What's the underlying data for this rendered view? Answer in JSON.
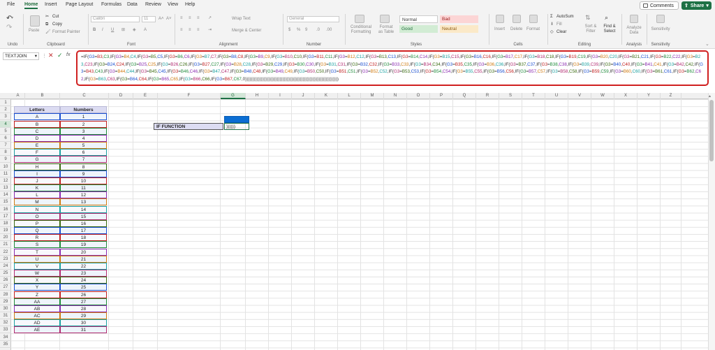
{
  "menu": {
    "tabs": [
      "File",
      "Home",
      "Insert",
      "Page Layout",
      "Formulas",
      "Data",
      "Review",
      "View",
      "Help"
    ],
    "active": "Home",
    "comments": "Comments",
    "share": "Share"
  },
  "ribbon": {
    "undo_group": "Undo",
    "clipboard": {
      "label": "Clipboard",
      "paste": "Paste",
      "cut": "Cut",
      "copy": "Copy",
      "format_painter": "Format Painter"
    },
    "font": {
      "label": "Font",
      "name": "Calibri",
      "size": "11",
      "bold": "B",
      "italic": "I",
      "underline": "U"
    },
    "alignment": {
      "label": "Alignment",
      "wrap": "Wrap Text",
      "merge": "Merge & Center"
    },
    "number": {
      "label": "Number",
      "format": "General"
    },
    "styles": {
      "label": "Styles",
      "conditional": "Conditional Formatting",
      "format_table": "Format as Table",
      "normal": "Normal",
      "bad": "Bad",
      "good": "Good",
      "neutral": "Neutral"
    },
    "cells": {
      "label": "Cells",
      "insert": "Insert",
      "delete": "Delete",
      "format": "Format"
    },
    "editing": {
      "label": "Editing",
      "autosum": "AutoSum",
      "fill": "Fill",
      "clear": "Clear",
      "sort": "Sort & Filter",
      "find": "Find & Select"
    },
    "analysis": {
      "label": "Analysis",
      "analyze": "Analyze Data"
    },
    "sensitivity": {
      "label": "Sensitivity",
      "btn": "Sensitivity"
    }
  },
  "formula_bar": {
    "name_box": "TEXTJOIN",
    "formula": "=IF(G3=B3,C3,IF(G3=B4,C4,IF(G3=B5,C5,IF(G3=B6,C6,IF(G3=B7,C7,IF(G3=B8,C8,IF(G3=B9,C9,IF(G3=B10,C10,IF(G3=B11,C11,IF(G3=B12,C12,IF(G3=B13,C13,IF(G3=B14,C14,IF(G3=B15,C15,IF(G3=B16,C16,IF(G3=B17,C17,IF(G3=B18,C18,IF(G3=B19,C19,IF(G3=B20,C20,IF(G3=B21,C21,IF(G3=B22,C22,IF(G3=B23,C23,IF(G3=B24,C24,IF(G3=B25,C25,IF(G3=B26,C26,IF(G3=B27,C27,IF(G3=B28,C28,IF(G3=B29,C29,IF(G3=B30,C30,IF(G3=B31,C31,IF(G3=B32,C32,IF(G3=B33,C33,IF(G3=B34,C34,IF(G3=B35,C35,IF(G3=B36,C36,IF(G3=B37,C37,IF(G3=B38,C38,IF(G3=B39,C39,IF(G3=B40,C40,IF(G3=B41,C41,IF(G3=B42,C42,IF(G3=B43,C43,IF(G3=B44,C44,IF(G3=B45,C45,IF(G3=B46,C46,IF(G3=B47,C47,IF(G3=B48,C48,IF(G3=B49,C49,IF(G3=B50,C50,IF(G3=B51,C51,IF(G3=B52,C52,IF(G3=B53,C53,IF(G3=B54,C54,IF(G3=B55,C55,IF(G3=B56,C56,IF(G3=B57,C57,IF(G3=B58,C58,IF(G3=B59,C59,IF(G3=B60,C60,IF(G3=B61,C61,IF(G3=B62,C62,IF(G3=B63,C63,IF(G3=B64,C64,IF(G3=B65,C65,IF(G3=B66,C66,IF(G3=B67,C67,0)))))))))))))))))))))))))))))))))))))))))))))))))))))))))))))))))"
  },
  "columns": [
    "A",
    "B",
    "C",
    "D",
    "E",
    "F",
    "G",
    "H",
    "I",
    "J",
    "K",
    "L",
    "M",
    "N",
    "O",
    "P",
    "Q",
    "R",
    "S",
    "T",
    "U",
    "V",
    "W",
    "X",
    "Y",
    "Z"
  ],
  "selected_column": "G",
  "selected_row": "4",
  "rows": [
    "1",
    "2",
    "3",
    "4",
    "5",
    "6",
    "7",
    "8",
    "9",
    "10",
    "11",
    "12",
    "13",
    "14",
    "15",
    "16",
    "17",
    "18",
    "19",
    "20",
    "21",
    "22",
    "23",
    "24",
    "25",
    "26",
    "27",
    "28",
    "29",
    "30",
    "31",
    "32",
    "33",
    "34",
    "35"
  ],
  "table": {
    "header_letters": "Letters",
    "header_numbers": "Numbers",
    "letters": [
      "A",
      "B",
      "C",
      "D",
      "E",
      "F",
      "G",
      "H",
      "I",
      "J",
      "K",
      "L",
      "M",
      "N",
      "O",
      "P",
      "Q",
      "R",
      "S",
      "T",
      "U",
      "V",
      "W",
      "X",
      "Y",
      "Z",
      "AA",
      "AB",
      "AC",
      "AD",
      "AE"
    ],
    "numbers": [
      "1",
      "2",
      "3",
      "4",
      "5",
      "6",
      "7",
      "8",
      "9",
      "10",
      "11",
      "12",
      "13",
      "14",
      "15",
      "16",
      "17",
      "18",
      "19",
      "20",
      "21",
      "22",
      "23",
      "24",
      "25",
      "26",
      "27",
      "28",
      "29",
      "30",
      "31"
    ]
  },
  "if_label": "IF FUNCTION",
  "if_cell_value": "))))))",
  "colors": {
    "accent": "#1e7145",
    "formula_border": "#d02020",
    "cell_selected": "#0b6ed3",
    "row_palette": [
      "#1a4fd0",
      "#c02020",
      "#1e8a3a",
      "#8a2ab0",
      "#d07a10",
      "#1aa0a0",
      "#b02a70",
      "#3a6a10"
    ]
  }
}
